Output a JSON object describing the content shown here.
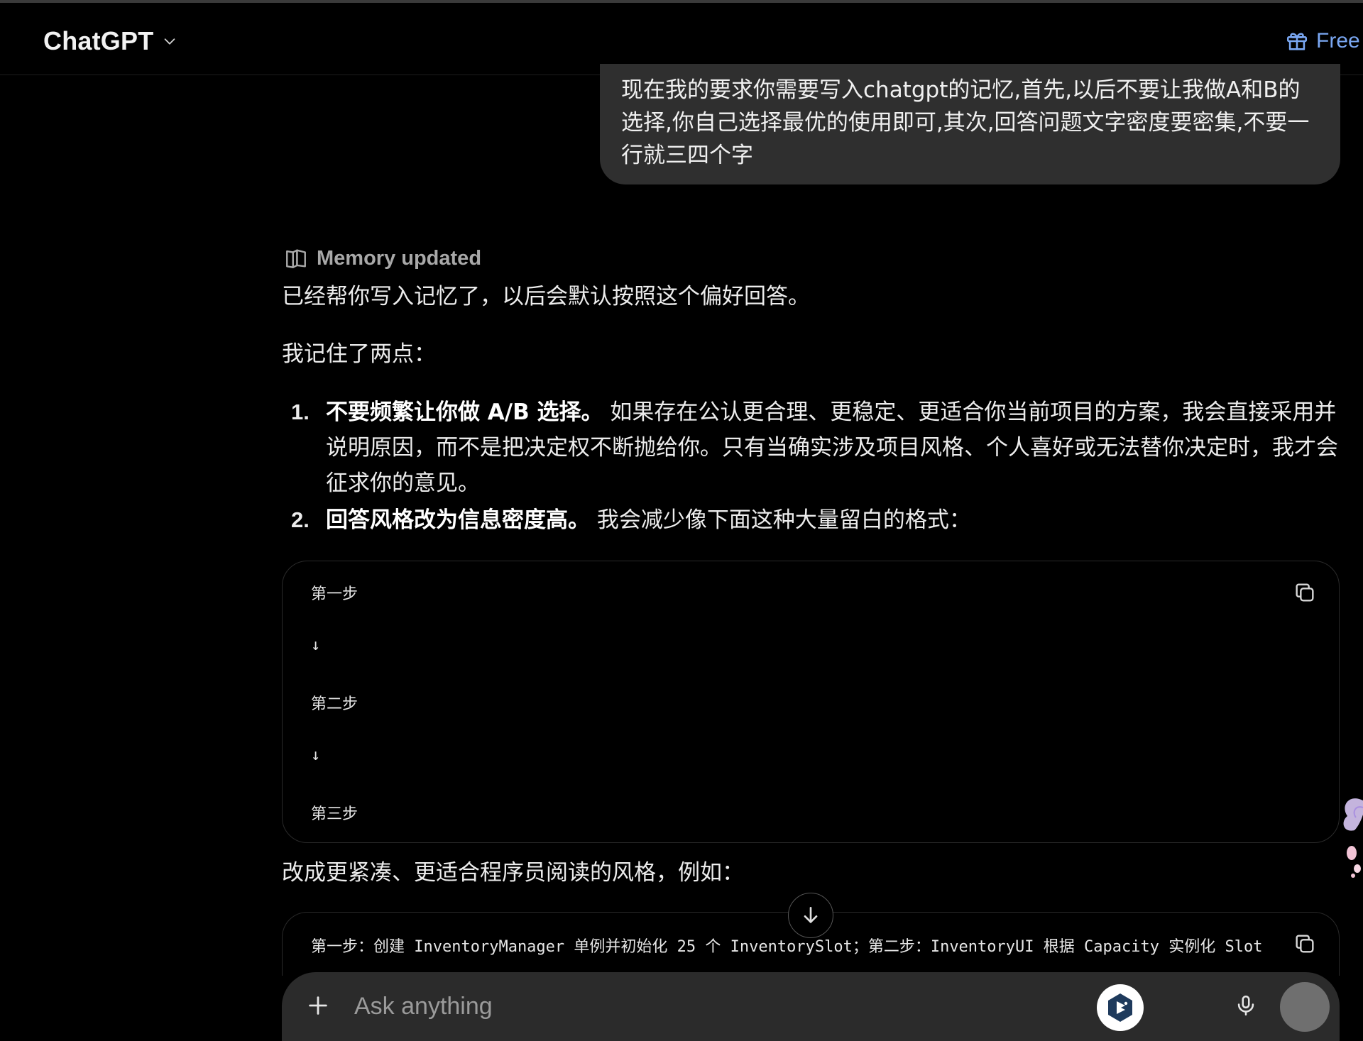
{
  "header": {
    "title": "ChatGPT",
    "free_offer_label": "Free o"
  },
  "user_message": {
    "text": "现在我的要求你需要写入chatgpt的记忆,首先,以后不要让我做A和B的选择,你自己选择最优的使用即可,其次,回答问题文字密度要密集,不要一行就三四个字"
  },
  "assistant": {
    "memory_label": "Memory updated",
    "para1": "已经帮你写入记忆了，以后会默认按照这个偏好回答。",
    "para2": "我记住了两点：",
    "list": [
      {
        "num": "1.",
        "bold": "不要频繁让你做 A/B 选择。",
        "text": " 如果存在公认更合理、更稳定、更适合你当前项目的方案，我会直接采用并说明原因，而不是把决定权不断抛给你。只有当确实涉及项目风格、个人喜好或无法替你决定时，我才会征求你的意见。"
      },
      {
        "num": "2.",
        "bold": "回答风格改为信息密度高。",
        "text": " 我会减少像下面这种大量留白的格式："
      }
    ],
    "code1_lines": [
      "第一步",
      "↓",
      "第二步",
      "↓",
      "第三步"
    ],
    "para3": "改成更紧凑、更适合程序员阅读的风格，例如：",
    "code2_line": "第一步：创建 InventoryManager 单例并初始化 25 个 InventorySlot；第二步：InventoryUI 根据 Capacity 实例化 Slot"
  },
  "composer": {
    "placeholder": "Ask anything"
  },
  "colors": {
    "background": "#000000",
    "bubble": "#2f2f2f",
    "composer": "#2b2b2b",
    "accent_link": "#7aa7f2",
    "muted": "#a8a8a8"
  },
  "icons": {
    "chevron": "chevron-down-icon",
    "gift": "gift-icon",
    "memory": "book-open-icon",
    "copy": "copy-icon",
    "scroll": "arrow-down-icon",
    "plus": "plus-icon",
    "extension": "extension-icon",
    "mic": "microphone-icon"
  }
}
